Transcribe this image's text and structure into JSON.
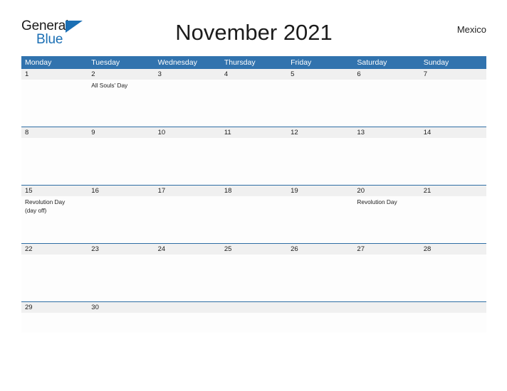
{
  "logo": {
    "word_top": "General",
    "word_bottom": "Blue",
    "flag_color": "#1b6fb4",
    "text_color": "#1a1a1a"
  },
  "header": {
    "title": "November 2021",
    "region": "Mexico"
  },
  "colors": {
    "header_blue": "#3173ae",
    "row_divider_blue": "#2e6da4",
    "date_strip_gray": "#f0f0f0",
    "page_background": "#ffffff",
    "text": "#1c1c1c"
  },
  "calendar": {
    "month": "November",
    "year": "2021",
    "weekdays": [
      "Monday",
      "Tuesday",
      "Wednesday",
      "Thursday",
      "Friday",
      "Saturday",
      "Sunday"
    ],
    "weeks": [
      {
        "height": "tall",
        "days": [
          {
            "date": "1",
            "events": []
          },
          {
            "date": "2",
            "events": [
              "All Souls' Day"
            ]
          },
          {
            "date": "3",
            "events": []
          },
          {
            "date": "4",
            "events": []
          },
          {
            "date": "5",
            "events": []
          },
          {
            "date": "6",
            "events": []
          },
          {
            "date": "7",
            "events": []
          }
        ]
      },
      {
        "height": "tall",
        "days": [
          {
            "date": "8",
            "events": []
          },
          {
            "date": "9",
            "events": []
          },
          {
            "date": "10",
            "events": []
          },
          {
            "date": "11",
            "events": []
          },
          {
            "date": "12",
            "events": []
          },
          {
            "date": "13",
            "events": []
          },
          {
            "date": "14",
            "events": []
          }
        ]
      },
      {
        "height": "tall",
        "days": [
          {
            "date": "15",
            "events": [
              "Revolution Day",
              "(day off)"
            ]
          },
          {
            "date": "16",
            "events": []
          },
          {
            "date": "17",
            "events": []
          },
          {
            "date": "18",
            "events": []
          },
          {
            "date": "19",
            "events": []
          },
          {
            "date": "20",
            "events": [
              "Revolution Day"
            ]
          },
          {
            "date": "21",
            "events": []
          }
        ]
      },
      {
        "height": "tall",
        "days": [
          {
            "date": "22",
            "events": []
          },
          {
            "date": "23",
            "events": []
          },
          {
            "date": "24",
            "events": []
          },
          {
            "date": "25",
            "events": []
          },
          {
            "date": "26",
            "events": []
          },
          {
            "date": "27",
            "events": []
          },
          {
            "date": "28",
            "events": []
          }
        ]
      },
      {
        "height": "short",
        "days": [
          {
            "date": "29",
            "events": []
          },
          {
            "date": "30",
            "events": []
          },
          {
            "date": "",
            "events": []
          },
          {
            "date": "",
            "events": []
          },
          {
            "date": "",
            "events": []
          },
          {
            "date": "",
            "events": []
          },
          {
            "date": "",
            "events": []
          }
        ]
      }
    ]
  }
}
